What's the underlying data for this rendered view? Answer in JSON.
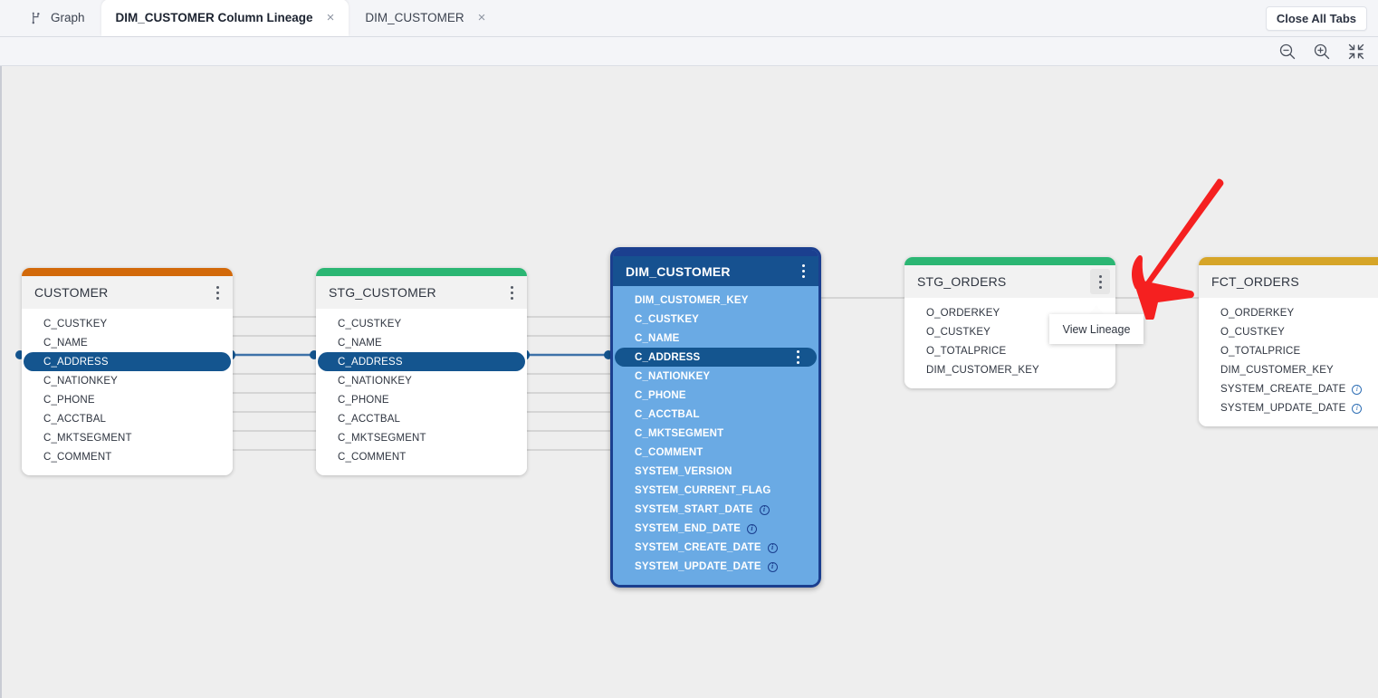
{
  "window": {
    "close_all_tabs_label": "Close All Tabs"
  },
  "tabs": [
    {
      "label": "Graph",
      "icon": "branch-icon",
      "active": false,
      "closable": false
    },
    {
      "label": "DIM_CUSTOMER Column Lineage",
      "active": true,
      "closable": true,
      "close_label": "×"
    },
    {
      "label": "DIM_CUSTOMER",
      "active": false,
      "closable": true,
      "close_label": "×"
    }
  ],
  "toolbar": {
    "zoom_out": "zoom-out-icon",
    "zoom_in": "zoom-in-icon",
    "fit_screen": "fit-screen-icon"
  },
  "popup": {
    "view_lineage_label": "View Lineage"
  },
  "annotation": {
    "arrow_color": "#f52020",
    "points_to": "stg-orders-kebab-menu"
  },
  "colors": {
    "customer_accent": "#d2690a",
    "stg_customer_accent": "#2bb673",
    "dim_customer_accent": "#1b3f8f",
    "stg_orders_accent": "#2bb673",
    "fct_orders_accent": "#d6a528",
    "highlight_pill": "#14558f",
    "selected_node_body": "#6aaae4",
    "edge_default": "#c6c6c6",
    "edge_highlight": "#3d72a8"
  },
  "nodes": {
    "customer": {
      "title": "CUSTOMER",
      "menu": "kebab-menu",
      "columns": [
        {
          "name": "C_CUSTKEY",
          "highlighted": false,
          "info": false
        },
        {
          "name": "C_NAME",
          "highlighted": false,
          "info": false
        },
        {
          "name": "C_ADDRESS",
          "highlighted": true,
          "info": false
        },
        {
          "name": "C_NATIONKEY",
          "highlighted": false,
          "info": false
        },
        {
          "name": "C_PHONE",
          "highlighted": false,
          "info": false
        },
        {
          "name": "C_ACCTBAL",
          "highlighted": false,
          "info": false
        },
        {
          "name": "C_MKTSEGMENT",
          "highlighted": false,
          "info": false
        },
        {
          "name": "C_COMMENT",
          "highlighted": false,
          "info": false
        }
      ]
    },
    "stg_customer": {
      "title": "STG_CUSTOMER",
      "menu": "kebab-menu",
      "columns": [
        {
          "name": "C_CUSTKEY",
          "highlighted": false,
          "info": false
        },
        {
          "name": "C_NAME",
          "highlighted": false,
          "info": false
        },
        {
          "name": "C_ADDRESS",
          "highlighted": true,
          "info": false
        },
        {
          "name": "C_NATIONKEY",
          "highlighted": false,
          "info": false
        },
        {
          "name": "C_PHONE",
          "highlighted": false,
          "info": false
        },
        {
          "name": "C_ACCTBAL",
          "highlighted": false,
          "info": false
        },
        {
          "name": "C_MKTSEGMENT",
          "highlighted": false,
          "info": false
        },
        {
          "name": "C_COMMENT",
          "highlighted": false,
          "info": false
        }
      ]
    },
    "dim_customer": {
      "title": "DIM_CUSTOMER",
      "menu": "kebab-menu",
      "selected": true,
      "columns": [
        {
          "name": "DIM_CUSTOMER_KEY",
          "highlighted": false,
          "info": false
        },
        {
          "name": "C_CUSTKEY",
          "highlighted": false,
          "info": false
        },
        {
          "name": "C_NAME",
          "highlighted": false,
          "info": false
        },
        {
          "name": "C_ADDRESS",
          "highlighted": true,
          "info": false,
          "menu": "kebab-menu"
        },
        {
          "name": "C_NATIONKEY",
          "highlighted": false,
          "info": false
        },
        {
          "name": "C_PHONE",
          "highlighted": false,
          "info": false
        },
        {
          "name": "C_ACCTBAL",
          "highlighted": false,
          "info": false
        },
        {
          "name": "C_MKTSEGMENT",
          "highlighted": false,
          "info": false
        },
        {
          "name": "C_COMMENT",
          "highlighted": false,
          "info": false
        },
        {
          "name": "SYSTEM_VERSION",
          "highlighted": false,
          "info": false
        },
        {
          "name": "SYSTEM_CURRENT_FLAG",
          "highlighted": false,
          "info": false
        },
        {
          "name": "SYSTEM_START_DATE",
          "highlighted": false,
          "info": true
        },
        {
          "name": "SYSTEM_END_DATE",
          "highlighted": false,
          "info": true
        },
        {
          "name": "SYSTEM_CREATE_DATE",
          "highlighted": false,
          "info": true
        },
        {
          "name": "SYSTEM_UPDATE_DATE",
          "highlighted": false,
          "info": true
        }
      ]
    },
    "stg_orders": {
      "title": "STG_ORDERS",
      "menu": "kebab-menu",
      "columns": [
        {
          "name": "O_ORDERKEY",
          "highlighted": false,
          "info": false
        },
        {
          "name": "O_CUSTKEY",
          "highlighted": false,
          "info": false
        },
        {
          "name": "O_TOTALPRICE",
          "highlighted": false,
          "info": false
        },
        {
          "name": "DIM_CUSTOMER_KEY",
          "highlighted": false,
          "info": false
        }
      ]
    },
    "fct_orders": {
      "title": "FCT_ORDERS",
      "menu": "kebab-menu",
      "columns": [
        {
          "name": "O_ORDERKEY",
          "highlighted": false,
          "info": false
        },
        {
          "name": "O_CUSTKEY",
          "highlighted": false,
          "info": false
        },
        {
          "name": "O_TOTALPRICE",
          "highlighted": false,
          "info": false
        },
        {
          "name": "DIM_CUSTOMER_KEY",
          "highlighted": false,
          "info": false
        },
        {
          "name": "SYSTEM_CREATE_DATE",
          "highlighted": false,
          "info": true
        },
        {
          "name": "SYSTEM_UPDATE_DATE",
          "highlighted": false,
          "info": true
        }
      ]
    }
  }
}
